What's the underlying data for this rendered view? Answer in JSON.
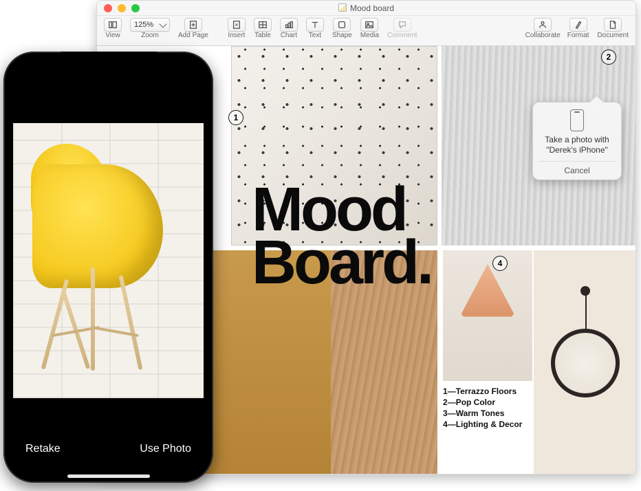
{
  "window": {
    "title": "Mood board",
    "zoom_label": "125%"
  },
  "toolbar": {
    "view": "View",
    "zoom": "Zoom",
    "add_page": "Add Page",
    "insert": "Insert",
    "table": "Table",
    "chart": "Chart",
    "text": "Text",
    "shape": "Shape",
    "media": "Media",
    "comment": "Comment",
    "collaborate": "Collaborate",
    "format": "Format",
    "document": "Document"
  },
  "canvas": {
    "title_line1": "Mood",
    "title_line2": "Board.",
    "badges": {
      "b1": "1",
      "b2": "2",
      "b4": "4"
    },
    "legend": [
      {
        "num": "1",
        "label": "Terrazzo Floors"
      },
      {
        "num": "2",
        "label": "Pop Color"
      },
      {
        "num": "3",
        "label": "Warm Tones"
      },
      {
        "num": "4",
        "label": "Lighting & Decor"
      }
    ]
  },
  "popover": {
    "message": "Take a photo with \"Derek's iPhone\"",
    "cancel": "Cancel"
  },
  "iphone": {
    "retake": "Retake",
    "use_photo": "Use Photo"
  }
}
